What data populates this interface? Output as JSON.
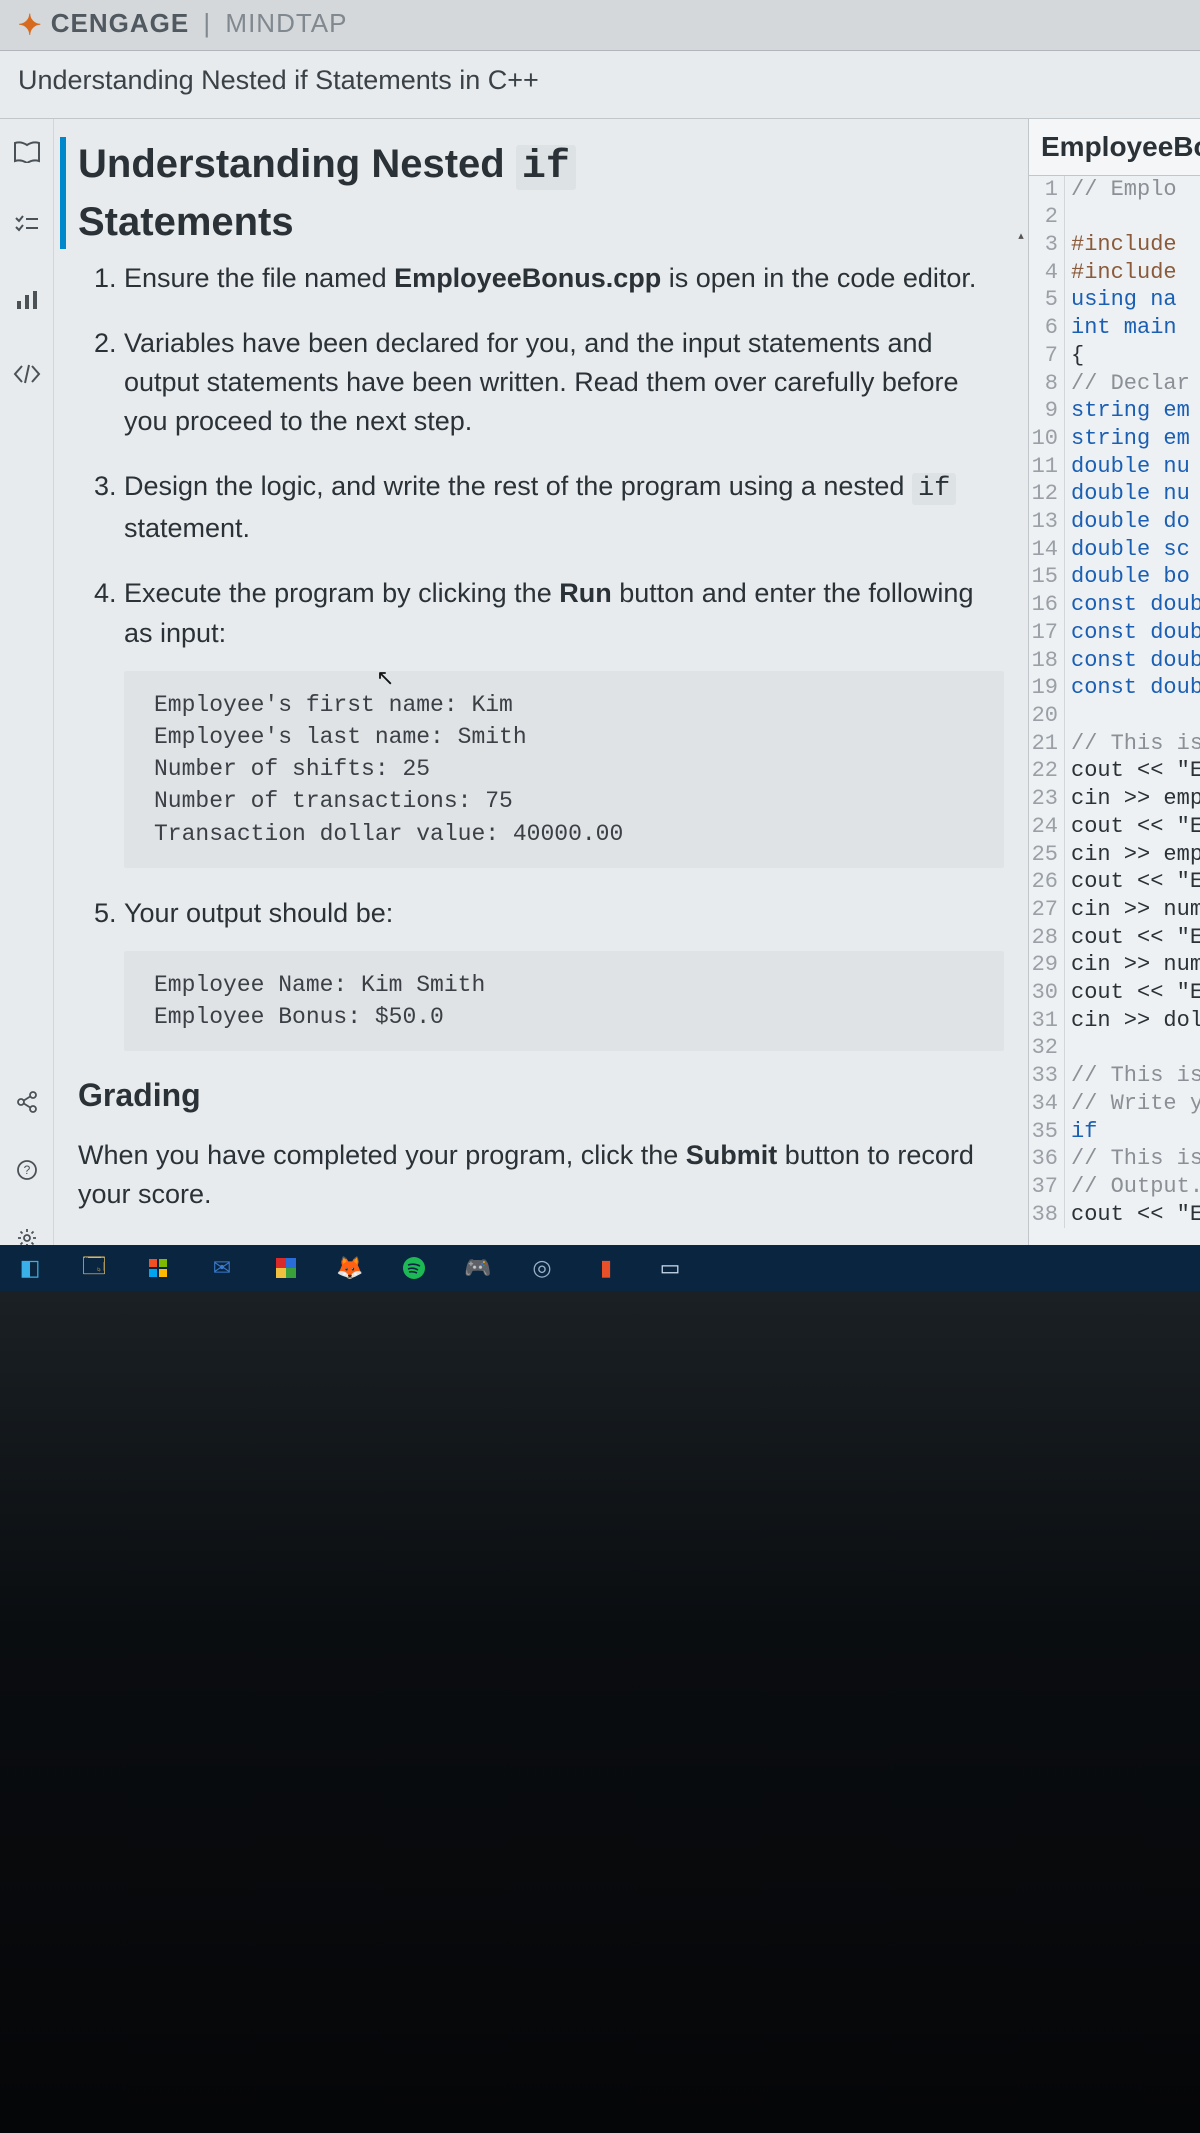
{
  "header": {
    "brand1": "CENGAGE",
    "sep": "|",
    "brand2": "MINDTAP"
  },
  "breadcrumb": "Understanding Nested if Statements in C++",
  "panel_title_part1": "Understanding Nested ",
  "panel_title_mono": "if",
  "panel_title_part2": " Statements",
  "instructions": {
    "li1_a": "Ensure the file named ",
    "li1_file": "EmployeeBonus.cpp",
    "li1_b": " is open in the code editor.",
    "li2": "Variables have been declared for you, and the input statements and output statements have been written. Read them over carefully before you proceed to the next step.",
    "li3_a": "Design the logic, and write the rest of the program using a nested ",
    "li3_mono": "if",
    "li3_b": " statement.",
    "li4_a": "Execute the program by clicking the ",
    "li4_strong": "Run",
    "li4_b": " button and enter the following as input:",
    "code1": "Employee's first name: Kim\nEmployee's last name: Smith\nNumber of shifts: 25\nNumber of transactions: 75\nTransaction dollar value: 40000.00",
    "li5": "Your output should be:",
    "code2": "Employee Name: Kim Smith\nEmployee Bonus: $50.0"
  },
  "grading": {
    "heading": "Grading",
    "text_a": "When you have completed your program, click the ",
    "text_strong": "Submit",
    "text_b": " button to record your score."
  },
  "editor": {
    "tab": "EmployeeBo",
    "lines": [
      {
        "n": 1,
        "cls": "tok-comment",
        "t": "// Emplo"
      },
      {
        "n": 2,
        "cls": "",
        "t": ""
      },
      {
        "n": 3,
        "cls": "tok-pre",
        "t": "#include"
      },
      {
        "n": 4,
        "cls": "tok-pre",
        "t": "#include"
      },
      {
        "n": 5,
        "cls": "tok-kw",
        "t": "using na"
      },
      {
        "n": 6,
        "cls": "tok-type",
        "t": "int main"
      },
      {
        "n": 7,
        "cls": "",
        "t": "{"
      },
      {
        "n": 8,
        "cls": "tok-comment",
        "t": "// Declar"
      },
      {
        "n": 9,
        "cls": "tok-type",
        "t": "string em"
      },
      {
        "n": 10,
        "cls": "tok-type",
        "t": "string em"
      },
      {
        "n": 11,
        "cls": "tok-type",
        "t": "double nu"
      },
      {
        "n": 12,
        "cls": "tok-type",
        "t": "double nu"
      },
      {
        "n": 13,
        "cls": "tok-type",
        "t": "double do"
      },
      {
        "n": 14,
        "cls": "tok-type",
        "t": "double sc"
      },
      {
        "n": 15,
        "cls": "tok-type",
        "t": "double bo"
      },
      {
        "n": 16,
        "cls": "tok-kw",
        "t": "const doub"
      },
      {
        "n": 17,
        "cls": "tok-kw",
        "t": "const doub"
      },
      {
        "n": 18,
        "cls": "tok-kw",
        "t": "const doub"
      },
      {
        "n": 19,
        "cls": "tok-kw",
        "t": "const doub"
      },
      {
        "n": 20,
        "cls": "",
        "t": ""
      },
      {
        "n": 21,
        "cls": "tok-comment",
        "t": "// This is"
      },
      {
        "n": 22,
        "cls": "",
        "t": "cout << \"E"
      },
      {
        "n": 23,
        "cls": "",
        "t": "cin >> empl"
      },
      {
        "n": 24,
        "cls": "",
        "t": "cout << \"En"
      },
      {
        "n": 25,
        "cls": "",
        "t": "cin >> empl"
      },
      {
        "n": 26,
        "cls": "",
        "t": "cout << \"En"
      },
      {
        "n": 27,
        "cls": "",
        "t": "cin >> numS"
      },
      {
        "n": 28,
        "cls": "",
        "t": "cout << \"En"
      },
      {
        "n": 29,
        "cls": "",
        "t": "cin >> numT"
      },
      {
        "n": 30,
        "cls": "",
        "t": "cout << \"Ent"
      },
      {
        "n": 31,
        "cls": "",
        "t": "cin >> dolla"
      },
      {
        "n": 32,
        "cls": "",
        "t": ""
      },
      {
        "n": 33,
        "cls": "tok-comment",
        "t": "// This is t"
      },
      {
        "n": 34,
        "cls": "tok-comment",
        "t": "// Write you"
      },
      {
        "n": 35,
        "cls": "tok-kw",
        "t": "if"
      },
      {
        "n": 36,
        "cls": "tok-comment",
        "t": "// This is th"
      },
      {
        "n": 37,
        "cls": "tok-comment",
        "t": "// Output."
      },
      {
        "n": 38,
        "cls": "",
        "t": "cout << \"Empl"
      }
    ]
  }
}
